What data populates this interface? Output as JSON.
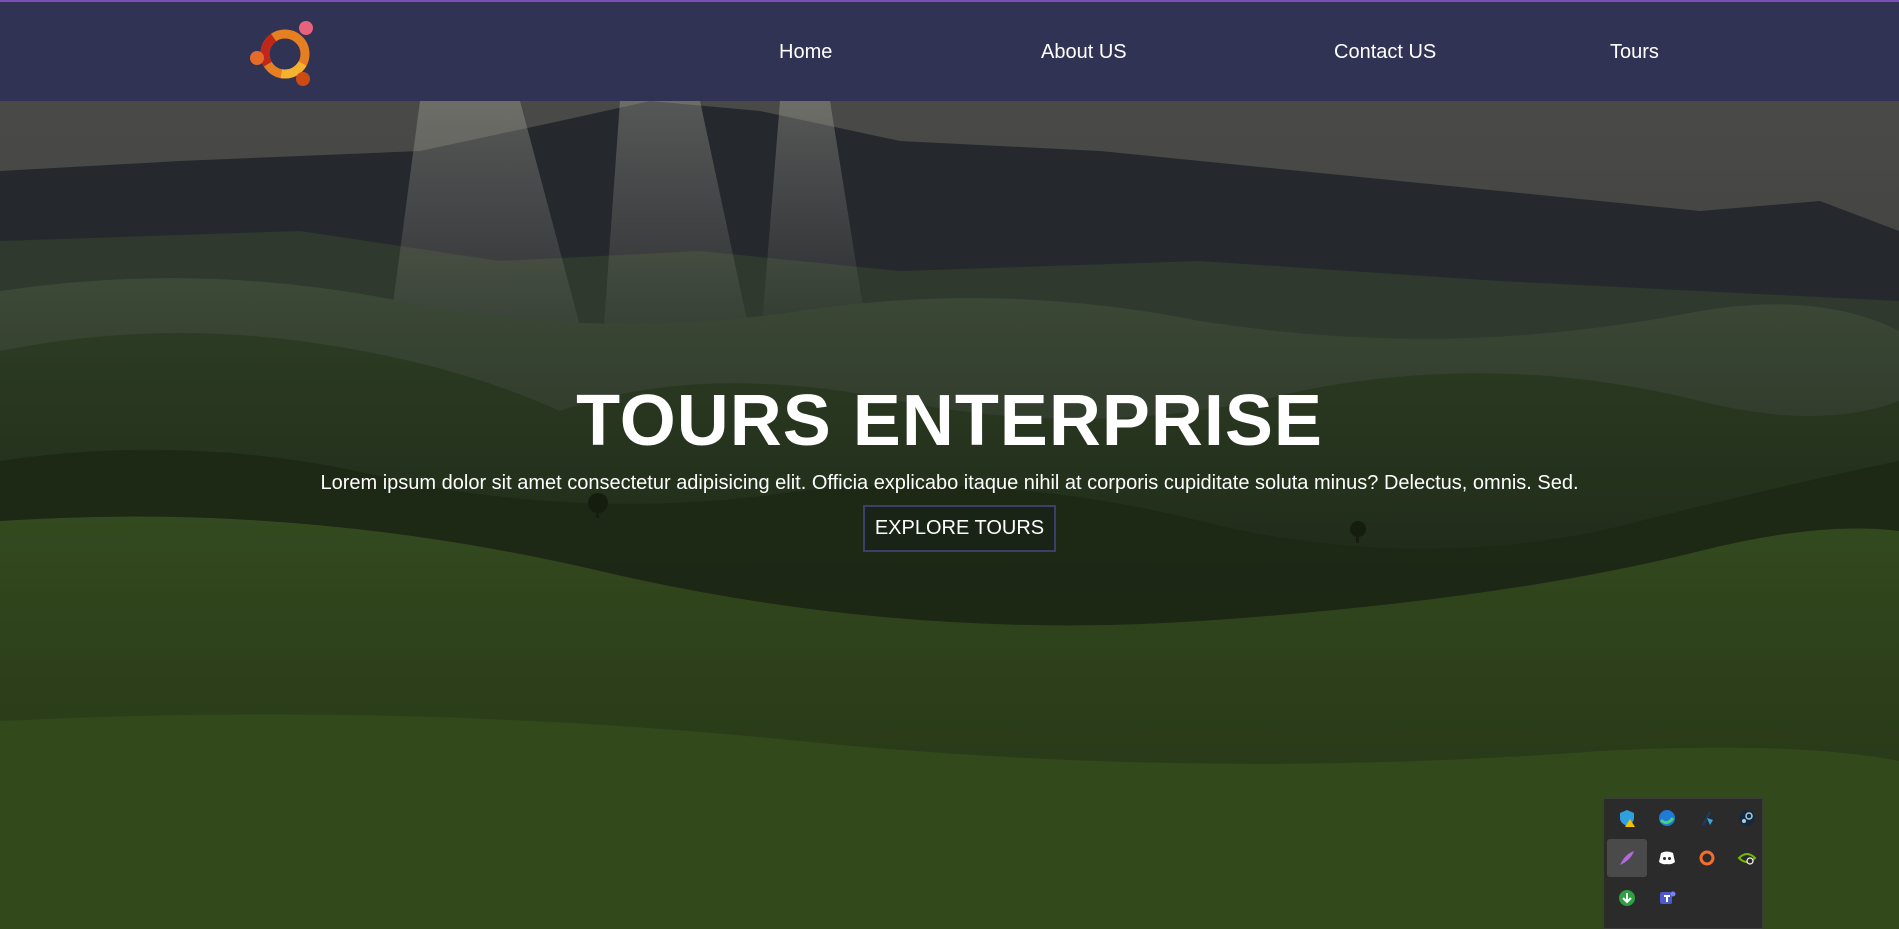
{
  "navbar": {
    "logo_icon": "ubuntu-circle-of-friends-logo",
    "links": [
      "Home",
      "About US",
      "Contact US",
      "Tours"
    ]
  },
  "hero": {
    "title": "TOURS ENTERPRISE",
    "text": "Lorem ipsum dolor sit amet consectetur adipisicing elit. Officia explicabo itaque nihil at corporis cupiditate soluta minus? Delectus, omnis. Sed.",
    "button_label": "EXPLORE TOURS",
    "background": "green rolling hills with mountains and sun rays"
  },
  "tray": {
    "icons": [
      "defender-warning-icon",
      "edge-icon",
      "wacom-tablet-icon",
      "steam-icon",
      "quill-feather-icon",
      "discord-icon",
      "origin-icon",
      "nvidia-icon",
      "green-update-icon",
      "teams-icon"
    ]
  },
  "colors": {
    "navbar_bg": "#313354",
    "top_line": "#7b4fb8",
    "button_border": "#3b3f6a",
    "text": "#ffffff"
  }
}
